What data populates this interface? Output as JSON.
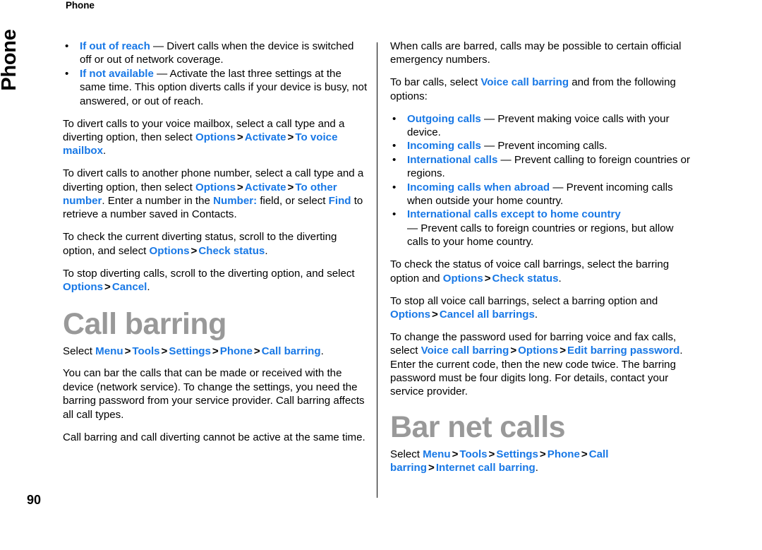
{
  "page": {
    "running_header": "Phone",
    "chapter_tab": "Phone",
    "folio": "90",
    "accent_color": "#1878e6",
    "heading_color": "#999999",
    "body_color": "#000000",
    "bullet_glyph": "•",
    "gt_glyph": ">",
    "dash_glyph": "—"
  },
  "left_column": {
    "bullets": [
      {
        "term": "If out of reach",
        "dash": "—",
        "desc": "Divert calls when the device is switched off or out of network coverage."
      },
      {
        "term": "If not available",
        "dash": "—",
        "desc": "Activate the last three settings at the same time. This option diverts calls if your device is busy, not answered, or out of reach."
      }
    ],
    "para_voice_mailbox": {
      "t1": "To divert calls to your voice mailbox, select a call type and a diverting option, then select ",
      "ui1": "Options",
      "gt1": ">",
      "ui2": "Activate",
      "gt2": ">",
      "ui3": "To voice mailbox",
      "t2": "."
    },
    "para_other_number": {
      "t1": "To divert calls to another phone number, select a call type and a diverting option, then select ",
      "ui1": "Options",
      "gt1": ">",
      "ui2": "Activate",
      "gt2": ">",
      "ui3": "To other number",
      "t2": ". Enter a number in the ",
      "ui4": "Number:",
      "t3": " field, or select ",
      "ui5": "Find",
      "t4": " to retrieve a number saved in Contacts."
    },
    "para_check_status": {
      "t1": "To check the current diverting status, scroll to the diverting option, and select ",
      "ui1": "Options",
      "gt1": ">",
      "ui2": "Check status",
      "t2": "."
    },
    "para_stop_diverting": {
      "t1": "To stop diverting calls, scroll to the diverting option, and select ",
      "ui1": "Options",
      "gt1": ">",
      "ui2": "Cancel",
      "t2": "."
    },
    "section_call_barring": {
      "title": "Call barring",
      "path": {
        "t1": "Select ",
        "ui1": "Menu",
        "gt1": ">",
        "ui2": "Tools",
        "gt2": ">",
        "ui3": "Settings",
        "gt3": ">",
        "ui4": "Phone",
        "gt4": ">",
        "ui5": "Call barring",
        "t2": "."
      },
      "para_bar_calls": "You can bar the calls that can be made or received with the device (network service). To change the settings, you need the barring password from your service provider. Call barring affects all call types.",
      "para_cannot_active": "Call barring and call diverting cannot be active at the same time."
    }
  },
  "right_column": {
    "para_emergency": "When calls are barred, calls may be possible to certain official emergency numbers.",
    "para_to_bar_calls": {
      "t1": "To bar calls, select ",
      "ui1": "Voice call barring",
      "t2": " and from the following options:"
    },
    "bullets": [
      {
        "term": "Outgoing calls",
        "dash": "—",
        "desc": "Prevent making voice calls with your device."
      },
      {
        "term": "Incoming calls",
        "dash": "—",
        "desc": "Prevent incoming calls."
      },
      {
        "term": "International calls",
        "dash": "—",
        "desc": "Prevent calling to foreign countries or regions."
      },
      {
        "term": "Incoming calls when abroad",
        "dash": "—",
        "desc": "Prevent incoming calls when outside your home country."
      },
      {
        "term": "International calls except to home country",
        "dash": "—",
        "desc": "Prevent calls to foreign countries or regions, but allow calls to your home country.",
        "wrap_before_dash": true
      }
    ],
    "para_check_status": {
      "t1": "To check the status of voice call barrings, select the barring option and ",
      "ui1": "Options",
      "gt1": ">",
      "ui2": "Check status",
      "t2": "."
    },
    "para_stop_all": {
      "t1": "To stop all voice call barrings, select a barring option and ",
      "ui1": "Options",
      "gt1": ">",
      "ui2": "Cancel all barrings",
      "t2": "."
    },
    "para_change_password": {
      "t1": "To change the password used for barring voice and fax calls, select ",
      "ui1": "Voice call barring",
      "gt1": ">",
      "ui2": "Options",
      "gt2": ">",
      "ui3": "Edit barring password",
      "t2": ". Enter the current code, then the new code twice. The barring password must be four digits long. For details, contact your service provider."
    },
    "section_bar_net_calls": {
      "title": "Bar net calls",
      "path": {
        "t1": "Select ",
        "ui1": "Menu",
        "gt1": ">",
        "ui2": "Tools",
        "gt2": ">",
        "ui3": "Settings",
        "gt3": ">",
        "ui4": "Phone",
        "gt4": ">",
        "ui5": "Call barring",
        "gt5": ">",
        "ui6": "Internet call barring",
        "t2": "."
      }
    }
  }
}
